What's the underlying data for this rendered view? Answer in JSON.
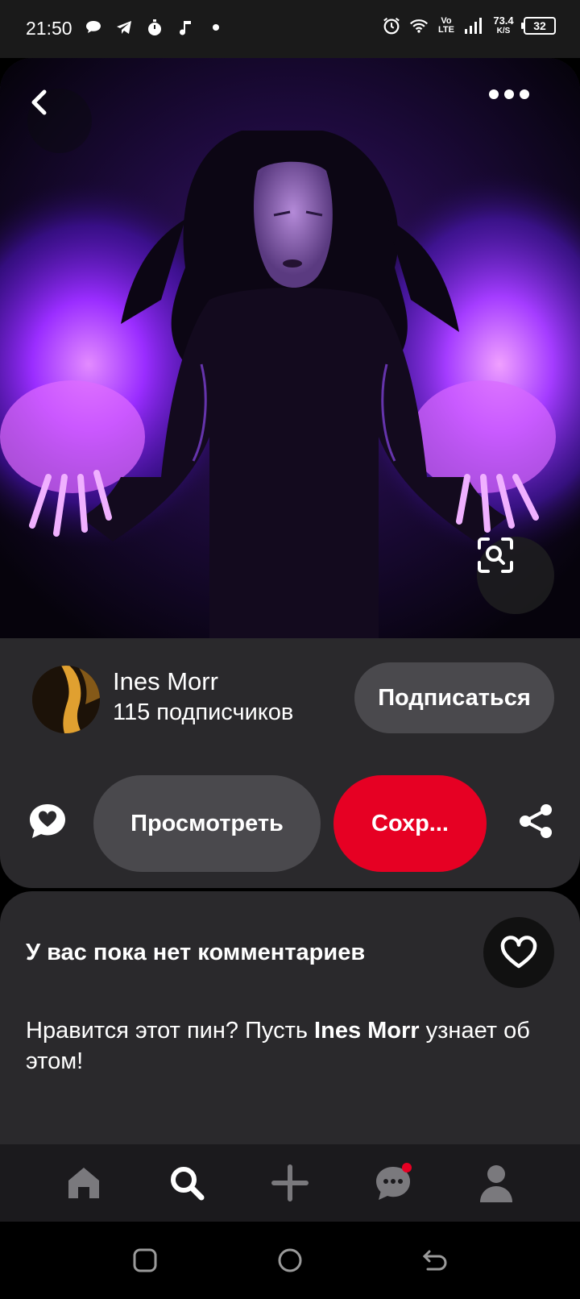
{
  "status_bar": {
    "time": "21:50",
    "net_speed_value": "73.4",
    "net_speed_unit": "K/S",
    "network_label_top": "Vo",
    "network_label_bottom": "LTE",
    "battery": "32",
    "left_icons": [
      "message-bubble-icon",
      "telegram-icon",
      "stopwatch-icon",
      "music-note-icon",
      "dot-icon"
    ],
    "right_icons": [
      "alarm-icon",
      "wifi-icon",
      "volte-icon",
      "signal-icon",
      "battery-icon"
    ]
  },
  "pin": {
    "icons": {
      "back": "chevron-left-icon",
      "more": "more-dots-icon",
      "lens": "visual-search-icon"
    }
  },
  "creator": {
    "name": "Ines Morr",
    "followers": "115 подписчиков",
    "follow_label": "Подписаться"
  },
  "actions": {
    "view_label": "Просмотреть",
    "save_label": "Сохр...",
    "icons": {
      "comment": "comment-heart-icon",
      "share": "share-icon"
    }
  },
  "comments": {
    "empty_title": "У вас пока нет комментариев",
    "prompt_before": "Нравится этот пин? Пусть ",
    "prompt_name": "Ines Morr",
    "prompt_after": " узнает об этом!",
    "like_icon": "heart-outline-icon"
  },
  "bottom_nav": {
    "items": [
      {
        "name": "home",
        "icon": "home-icon",
        "active": false
      },
      {
        "name": "search",
        "icon": "search-icon",
        "active": true
      },
      {
        "name": "create",
        "icon": "plus-icon",
        "active": false
      },
      {
        "name": "messages",
        "icon": "chat-icon",
        "active": false,
        "has_notification": true
      },
      {
        "name": "profile",
        "icon": "profile-icon",
        "active": false
      }
    ]
  },
  "system_nav": [
    "recents-button",
    "home-button",
    "back-button"
  ],
  "colors": {
    "accent_red": "#e60023",
    "card_bg": "#2a292c",
    "button_gray": "#4a494d",
    "nav_bg": "#1b1a1d"
  }
}
